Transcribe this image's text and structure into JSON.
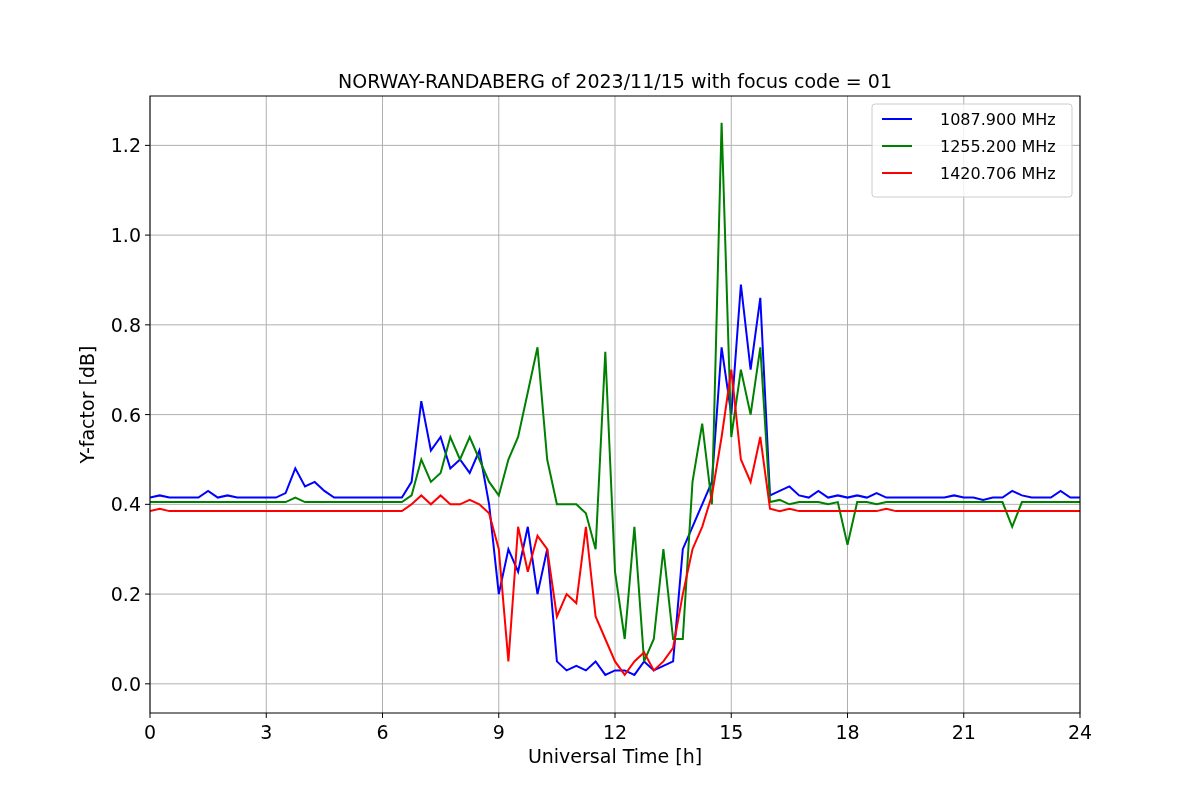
{
  "chart_data": {
    "type": "line",
    "title": "NORWAY-RANDABERG of 2023/11/15 with focus code = 01",
    "xlabel": "Universal Time [h]",
    "ylabel": "Y-factor [dB]",
    "x": [
      0,
      0.25,
      0.5,
      0.75,
      1,
      1.25,
      1.5,
      1.75,
      2,
      2.25,
      2.5,
      2.75,
      3,
      3.25,
      3.5,
      3.75,
      4,
      4.25,
      4.5,
      4.75,
      5,
      5.25,
      5.5,
      5.75,
      6,
      6.25,
      6.5,
      6.75,
      7,
      7.25,
      7.5,
      7.75,
      8,
      8.25,
      8.5,
      8.75,
      9,
      9.25,
      9.5,
      9.75,
      10,
      10.25,
      10.5,
      10.75,
      11,
      11.25,
      11.5,
      11.75,
      12,
      12.25,
      12.5,
      12.75,
      13,
      13.25,
      13.5,
      13.75,
      14,
      14.25,
      14.5,
      14.75,
      15,
      15.25,
      15.5,
      15.75,
      16,
      16.25,
      16.5,
      16.75,
      17,
      17.25,
      17.5,
      17.75,
      18,
      18.25,
      18.5,
      18.75,
      19,
      19.25,
      19.5,
      19.75,
      20,
      20.25,
      20.5,
      20.75,
      21,
      21.25,
      21.5,
      21.75,
      22,
      22.25,
      22.5,
      22.75,
      23,
      23.25,
      23.5,
      23.75,
      24
    ],
    "series": [
      {
        "name": "1087.900 MHz",
        "color": "#0000ff",
        "values": [
          0.415,
          0.42,
          0.415,
          0.415,
          0.415,
          0.415,
          0.43,
          0.415,
          0.42,
          0.415,
          0.415,
          0.415,
          0.415,
          0.415,
          0.425,
          0.48,
          0.44,
          0.45,
          0.43,
          0.415,
          0.415,
          0.415,
          0.415,
          0.415,
          0.415,
          0.415,
          0.415,
          0.45,
          0.63,
          0.52,
          0.55,
          0.48,
          0.5,
          0.47,
          0.52,
          0.4,
          0.2,
          0.3,
          0.25,
          0.35,
          0.2,
          0.3,
          0.05,
          0.03,
          0.04,
          0.03,
          0.05,
          0.02,
          0.03,
          0.03,
          0.02,
          0.05,
          0.03,
          0.04,
          0.05,
          0.3,
          0.35,
          0.4,
          0.45,
          0.75,
          0.6,
          0.89,
          0.7,
          0.86,
          0.42,
          0.43,
          0.44,
          0.42,
          0.415,
          0.43,
          0.415,
          0.42,
          0.415,
          0.42,
          0.415,
          0.425,
          0.415,
          0.415,
          0.415,
          0.415,
          0.415,
          0.415,
          0.415,
          0.42,
          0.415,
          0.415,
          0.41,
          0.415,
          0.415,
          0.43,
          0.42,
          0.415,
          0.415,
          0.415,
          0.43,
          0.415,
          0.415
        ]
      },
      {
        "name": "1255.200 MHz",
        "color": "#008000",
        "values": [
          0.405,
          0.405,
          0.405,
          0.405,
          0.405,
          0.405,
          0.405,
          0.405,
          0.405,
          0.405,
          0.405,
          0.405,
          0.405,
          0.405,
          0.405,
          0.415,
          0.405,
          0.405,
          0.405,
          0.405,
          0.405,
          0.405,
          0.405,
          0.405,
          0.405,
          0.405,
          0.405,
          0.42,
          0.5,
          0.45,
          0.47,
          0.55,
          0.5,
          0.55,
          0.5,
          0.45,
          0.42,
          0.5,
          0.55,
          0.65,
          0.75,
          0.5,
          0.4,
          0.4,
          0.4,
          0.38,
          0.3,
          0.74,
          0.25,
          0.1,
          0.35,
          0.05,
          0.1,
          0.3,
          0.1,
          0.1,
          0.45,
          0.58,
          0.4,
          1.25,
          0.55,
          0.7,
          0.6,
          0.75,
          0.405,
          0.41,
          0.4,
          0.405,
          0.405,
          0.405,
          0.4,
          0.405,
          0.31,
          0.405,
          0.405,
          0.4,
          0.405,
          0.405,
          0.405,
          0.405,
          0.405,
          0.405,
          0.405,
          0.405,
          0.405,
          0.405,
          0.405,
          0.405,
          0.405,
          0.35,
          0.405,
          0.405,
          0.405,
          0.405,
          0.405,
          0.405,
          0.405
        ]
      },
      {
        "name": "1420.706 MHz",
        "color": "#ff0000",
        "values": [
          0.385,
          0.39,
          0.385,
          0.385,
          0.385,
          0.385,
          0.385,
          0.385,
          0.385,
          0.385,
          0.385,
          0.385,
          0.385,
          0.385,
          0.385,
          0.385,
          0.385,
          0.385,
          0.385,
          0.385,
          0.385,
          0.385,
          0.385,
          0.385,
          0.385,
          0.385,
          0.385,
          0.4,
          0.42,
          0.4,
          0.42,
          0.4,
          0.4,
          0.41,
          0.4,
          0.38,
          0.3,
          0.05,
          0.35,
          0.25,
          0.33,
          0.3,
          0.15,
          0.2,
          0.18,
          0.35,
          0.15,
          0.1,
          0.05,
          0.02,
          0.05,
          0.07,
          0.03,
          0.05,
          0.08,
          0.2,
          0.3,
          0.35,
          0.42,
          0.55,
          0.7,
          0.5,
          0.45,
          0.55,
          0.39,
          0.385,
          0.39,
          0.385,
          0.385,
          0.385,
          0.385,
          0.385,
          0.385,
          0.385,
          0.385,
          0.385,
          0.39,
          0.385,
          0.385,
          0.385,
          0.385,
          0.385,
          0.385,
          0.385,
          0.385,
          0.385,
          0.385,
          0.385,
          0.385,
          0.385,
          0.385,
          0.385,
          0.385,
          0.385,
          0.385,
          0.385,
          0.385
        ]
      }
    ],
    "grid": true,
    "legend": "upper right",
    "xlim": [
      0,
      24
    ],
    "ylim": [
      -0.065,
      1.31
    ],
    "xticks": [
      0,
      3,
      6,
      9,
      12,
      15,
      18,
      21,
      24
    ],
    "yticks": [
      {
        "value": 0,
        "label": "0.0"
      },
      {
        "value": 0.2,
        "label": "0.2"
      },
      {
        "value": 0.4,
        "label": "0.4"
      },
      {
        "value": 0.6,
        "label": "0.6"
      },
      {
        "value": 0.8,
        "label": "0.8"
      },
      {
        "value": 1,
        "label": "1.0"
      },
      {
        "value": 1.2,
        "label": "1.2"
      }
    ]
  }
}
